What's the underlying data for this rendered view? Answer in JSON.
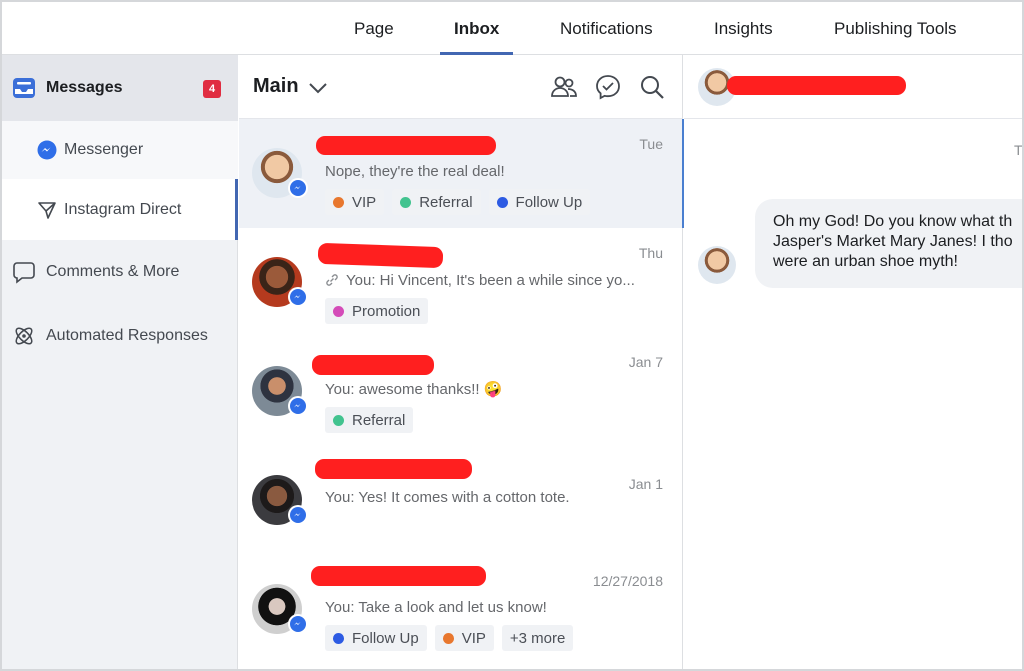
{
  "topnav": {
    "tabs": [
      {
        "label": "Page"
      },
      {
        "label": "Inbox"
      },
      {
        "label": "Notifications"
      },
      {
        "label": "Insights"
      },
      {
        "label": "Publishing Tools"
      }
    ],
    "active": "Inbox"
  },
  "sidebar": {
    "header": {
      "label": "Messages",
      "badge": "4"
    },
    "items": [
      {
        "label": "Messenger",
        "icon": "messenger-icon"
      },
      {
        "label": "Instagram Direct",
        "icon": "paper-plane-icon"
      },
      {
        "label": "Comments & More",
        "icon": "comment-icon"
      },
      {
        "label": "Automated Responses",
        "icon": "atom-icon"
      }
    ]
  },
  "list": {
    "title": "Main",
    "icons": [
      "people-icon",
      "chat-check-icon",
      "search-icon"
    ],
    "conversations": [
      {
        "date": "Tue",
        "preview": "Nope, they're the real deal!",
        "tags": [
          {
            "label": "VIP",
            "color": "#e8772e"
          },
          {
            "label": "Referral",
            "color": "#42c38f"
          },
          {
            "label": "Follow Up",
            "color": "#2d5be3"
          }
        ]
      },
      {
        "date": "Thu",
        "preview": "You: Hi Vincent, It's been a while since yo...",
        "tags": [
          {
            "label": "Promotion",
            "color": "#d44bb8"
          }
        ]
      },
      {
        "date": "Jan 7",
        "preview": "You: awesome thanks!! 🤪",
        "tags": [
          {
            "label": "Referral",
            "color": "#42c38f"
          }
        ]
      },
      {
        "date": "Jan 1",
        "preview": "You: Yes! It comes with a cotton tote.",
        "tags": []
      },
      {
        "date": "12/27/2018",
        "preview": "You: Take a look and let us know!",
        "tags": [
          {
            "label": "Follow Up",
            "color": "#2d5be3"
          },
          {
            "label": "VIP",
            "color": "#e8772e"
          },
          {
            "label": "+3 more",
            "color": ""
          }
        ]
      }
    ]
  },
  "chat": {
    "day_label": "Tu",
    "message": "Oh my God! Do you know what th Jasper's Market Mary Janes! I tho were an urban shoe myth!"
  },
  "colors": {
    "accent": "#4267b2",
    "redaction": "#ff1f1f",
    "messenger": "#2f6ee8",
    "badge": "#e02d41"
  }
}
